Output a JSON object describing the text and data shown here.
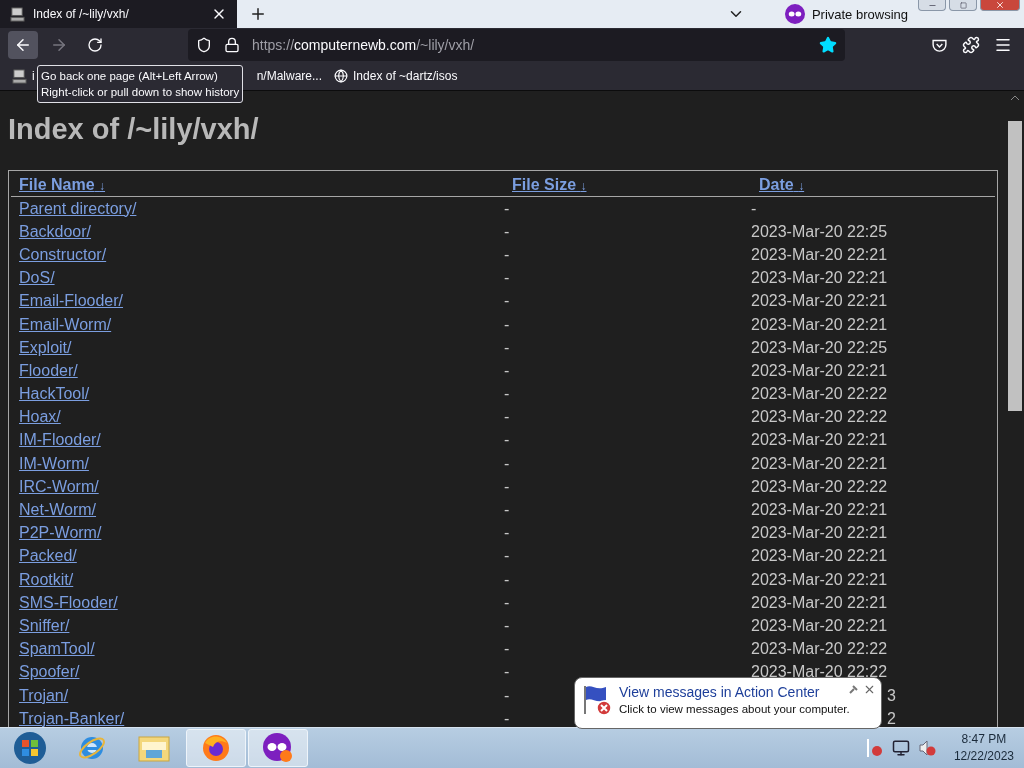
{
  "browser": {
    "tab": {
      "title": "Index of /~lily/vxh/",
      "selected": true
    },
    "private_label": "Private browsing",
    "url": {
      "host": "computernewb.com",
      "path": "/~lily/vxh/",
      "scheme": "https://"
    },
    "bookmarks": [
      "i",
      "n/Malware...",
      "Index of ~dartz/isos"
    ],
    "tooltip": [
      "Go back one page (Alt+Left Arrow)",
      "Right-click or pull down to show history"
    ]
  },
  "page": {
    "title": "Index of /~lily/vxh/",
    "columns": [
      {
        "label": "File Name",
        "sort": "↓"
      },
      {
        "label": "File Size",
        "sort": "↓"
      },
      {
        "label": "Date",
        "sort": "↓"
      }
    ],
    "rows": [
      {
        "name": "Parent directory/",
        "size": "-",
        "date": "-"
      },
      {
        "name": "Backdoor/",
        "size": "-",
        "date": "2023-Mar-20 22:25"
      },
      {
        "name": "Constructor/",
        "size": "-",
        "date": "2023-Mar-20 22:21"
      },
      {
        "name": "DoS/",
        "size": "-",
        "date": "2023-Mar-20 22:21"
      },
      {
        "name": "Email-Flooder/",
        "size": "-",
        "date": "2023-Mar-20 22:21"
      },
      {
        "name": "Email-Worm/",
        "size": "-",
        "date": "2023-Mar-20 22:21"
      },
      {
        "name": "Exploit/",
        "size": "-",
        "date": "2023-Mar-20 22:25"
      },
      {
        "name": "Flooder/",
        "size": "-",
        "date": "2023-Mar-20 22:21"
      },
      {
        "name": "HackTool/",
        "size": "-",
        "date": "2023-Mar-20 22:22"
      },
      {
        "name": "Hoax/",
        "size": "-",
        "date": "2023-Mar-20 22:22"
      },
      {
        "name": "IM-Flooder/",
        "size": "-",
        "date": "2023-Mar-20 22:21"
      },
      {
        "name": "IM-Worm/",
        "size": "-",
        "date": "2023-Mar-20 22:21"
      },
      {
        "name": "IRC-Worm/",
        "size": "-",
        "date": "2023-Mar-20 22:22"
      },
      {
        "name": "Net-Worm/",
        "size": "-",
        "date": "2023-Mar-20 22:21"
      },
      {
        "name": "P2P-Worm/",
        "size": "-",
        "date": "2023-Mar-20 22:21"
      },
      {
        "name": "Packed/",
        "size": "-",
        "date": "2023-Mar-20 22:21"
      },
      {
        "name": "Rootkit/",
        "size": "-",
        "date": "2023-Mar-20 22:21"
      },
      {
        "name": "SMS-Flooder/",
        "size": "-",
        "date": "2023-Mar-20 22:21"
      },
      {
        "name": "Sniffer/",
        "size": "-",
        "date": "2023-Mar-20 22:21"
      },
      {
        "name": "SpamTool/",
        "size": "-",
        "date": "2023-Mar-20 22:22"
      },
      {
        "name": "Spoofer/",
        "size": "-",
        "date": "2023-Mar-20 22:22"
      },
      {
        "name": "Trojan/",
        "size": "-",
        "date": "3",
        "cut": true
      },
      {
        "name": "Trojan-Banker/",
        "size": "-",
        "date": "2",
        "cut": true
      }
    ]
  },
  "notification": {
    "title": "View messages in Action Center",
    "text": "Click to view messages about your computer."
  },
  "taskbar": {
    "apps": [
      {
        "kind": "start",
        "selected": false
      },
      {
        "kind": "ie",
        "selected": false
      },
      {
        "kind": "explorer",
        "selected": false
      },
      {
        "kind": "firefox",
        "selected": true
      },
      {
        "kind": "private",
        "selected": true
      }
    ],
    "time": "8:47 PM",
    "date": "12/22/2023"
  }
}
